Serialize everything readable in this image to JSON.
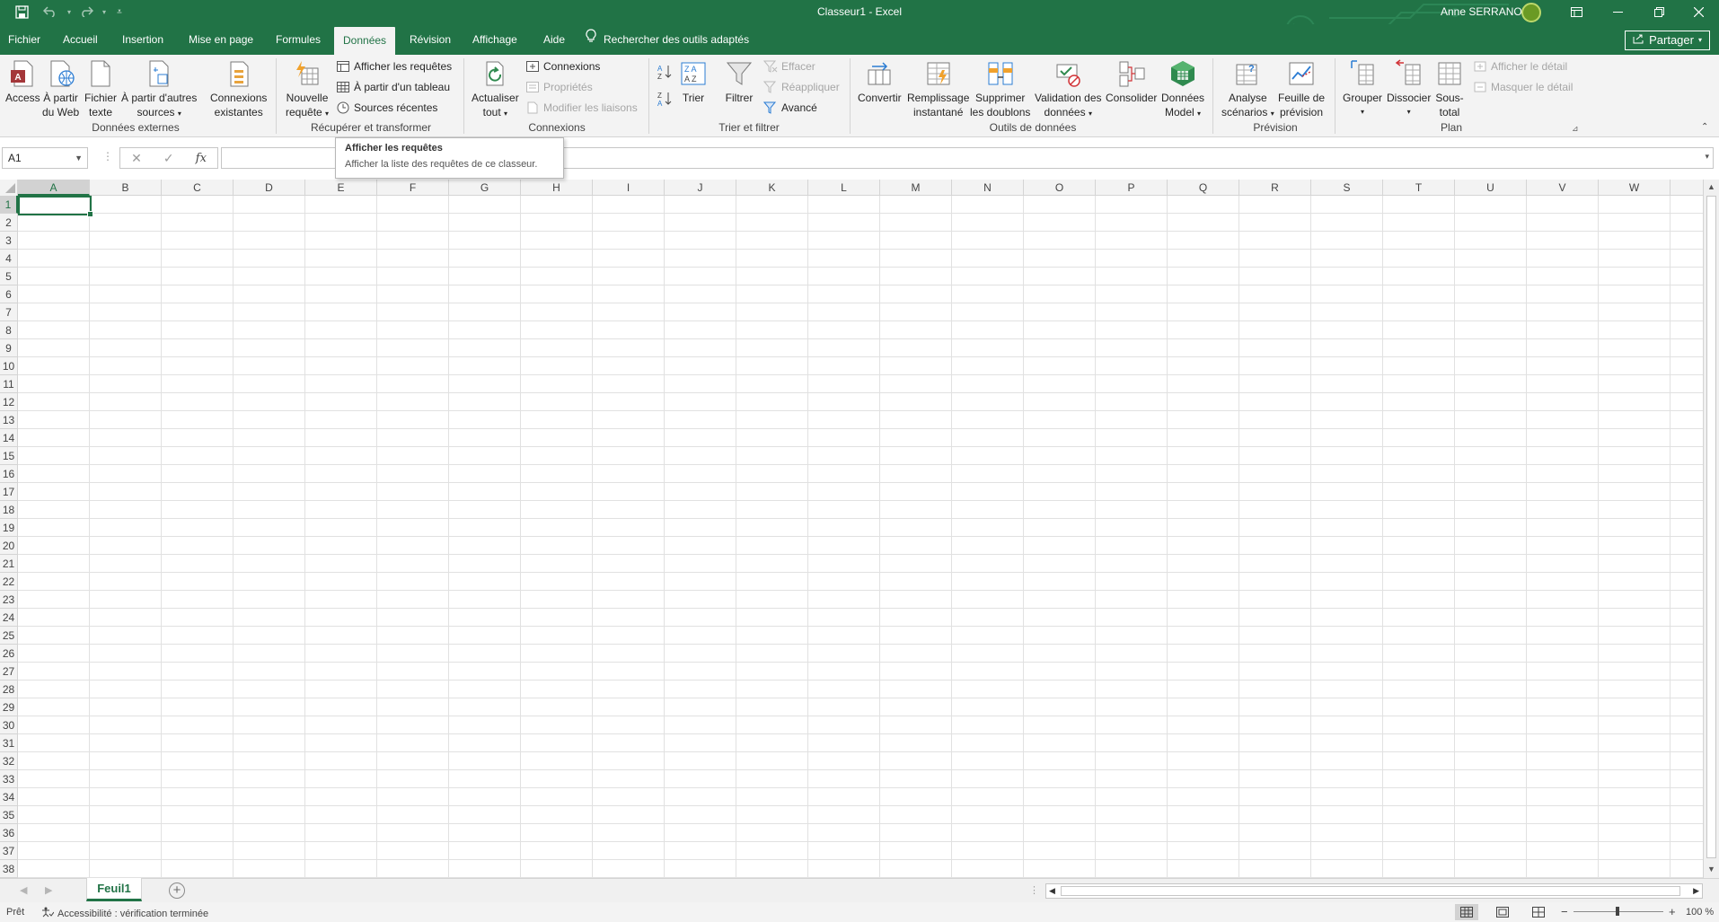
{
  "colors": {
    "brand": "#217346",
    "ribbon_bg": "#f3f3f3",
    "grid_line": "#e1e1e1"
  },
  "titlebar": {
    "title": "Classeur1  -  Excel",
    "user": "Anne SERRANO",
    "quick_access": [
      "save-icon",
      "undo-icon",
      "redo-icon",
      "customize-icon"
    ],
    "window_buttons": [
      "ribbon-display-icon",
      "minimize-icon",
      "restore-icon",
      "close-icon"
    ]
  },
  "tabs": [
    {
      "label": "Fichier"
    },
    {
      "label": "Accueil"
    },
    {
      "label": "Insertion"
    },
    {
      "label": "Mise en page"
    },
    {
      "label": "Formules"
    },
    {
      "label": "Données",
      "active": true
    },
    {
      "label": "Révision"
    },
    {
      "label": "Affichage"
    },
    {
      "label": "Aide"
    }
  ],
  "tellme": {
    "label": "Rechercher des outils adaptés",
    "icon": "lightbulb-icon"
  },
  "share": {
    "label": "Partager",
    "icon": "share-icon"
  },
  "ribbon": {
    "groups": [
      {
        "label": "Données externes"
      },
      {
        "label": "Récupérer et transformer"
      },
      {
        "label": "Connexions"
      },
      {
        "label": "Trier et filtrer"
      },
      {
        "label": "Outils de données"
      },
      {
        "label": "Prévision"
      },
      {
        "label": "Plan"
      }
    ],
    "external": [
      {
        "line1": "Access",
        "line2": "",
        "icon": "access-icon"
      },
      {
        "line1": "À partir",
        "line2": "du Web",
        "icon": "web-icon"
      },
      {
        "line1": "Fichier",
        "line2": "texte",
        "icon": "text-file-icon"
      },
      {
        "line1": "À partir d'autres",
        "line2": "sources",
        "icon": "other-sources-icon"
      },
      {
        "line1": "Connexions",
        "line2": "existantes",
        "icon": "existing-connections-icon"
      }
    ],
    "get_transform": {
      "new_query": {
        "line1": "Nouvelle",
        "line2": "requête"
      },
      "small": [
        "Afficher les requêtes",
        "À partir d'un tableau",
        "Sources récentes"
      ]
    },
    "connections": {
      "refresh": {
        "line1": "Actualiser",
        "line2": "tout"
      },
      "small": [
        "Connexions",
        "Propriétés",
        "Modifier les liaisons"
      ]
    },
    "sort_filter": {
      "sort": "Trier",
      "filter": "Filtrer",
      "small": [
        "Effacer",
        "Réappliquer",
        "Avancé"
      ]
    },
    "data_tools": [
      {
        "line1": "Convertir",
        "line2": ""
      },
      {
        "line1": "Remplissage",
        "line2": "instantané"
      },
      {
        "line1": "Supprimer",
        "line2": "les doublons"
      },
      {
        "line1": "Validation des",
        "line2": "données"
      },
      {
        "line1": "Consolider",
        "line2": ""
      },
      {
        "line1": "Données",
        "line2": "Model"
      }
    ],
    "forecast": [
      {
        "line1": "Analyse",
        "line2": "scénarios"
      },
      {
        "line1": "Feuille de",
        "line2": "prévision"
      }
    ],
    "outline": {
      "buttons": [
        {
          "line1": "Grouper",
          "line2": ""
        },
        {
          "line1": "Dissocier",
          "line2": ""
        },
        {
          "line1": "Sous-",
          "line2": "total"
        }
      ],
      "small": [
        "Afficher le détail",
        "Masquer le détail"
      ]
    }
  },
  "formula_bar": {
    "name_box": "A1",
    "fx": "fx",
    "cancel": "✕",
    "enter": "✓",
    "formula": ""
  },
  "columns": [
    "A",
    "B",
    "C",
    "D",
    "E",
    "F",
    "G",
    "H",
    "I",
    "J",
    "K",
    "L",
    "M",
    "N",
    "O",
    "P",
    "Q",
    "R",
    "S",
    "T",
    "U",
    "V",
    "W"
  ],
  "rows": [
    "1",
    "2",
    "3",
    "4",
    "5",
    "6",
    "7",
    "8",
    "9",
    "10",
    "11",
    "12",
    "13",
    "14",
    "15",
    "16",
    "17",
    "18",
    "19",
    "20",
    "21",
    "22",
    "23",
    "24",
    "25",
    "26",
    "27",
    "28",
    "29",
    "30",
    "31",
    "32",
    "33",
    "34",
    "35",
    "36",
    "37",
    "38"
  ],
  "sheet": {
    "name": "Feuil1"
  },
  "status": {
    "ready": "Prêt",
    "accessibility": "Accessibilité : vérification terminée",
    "zoom": "100 %"
  },
  "tooltip": {
    "title": "Afficher les requêtes",
    "description": "Afficher la liste des requêtes de ce classeur."
  }
}
